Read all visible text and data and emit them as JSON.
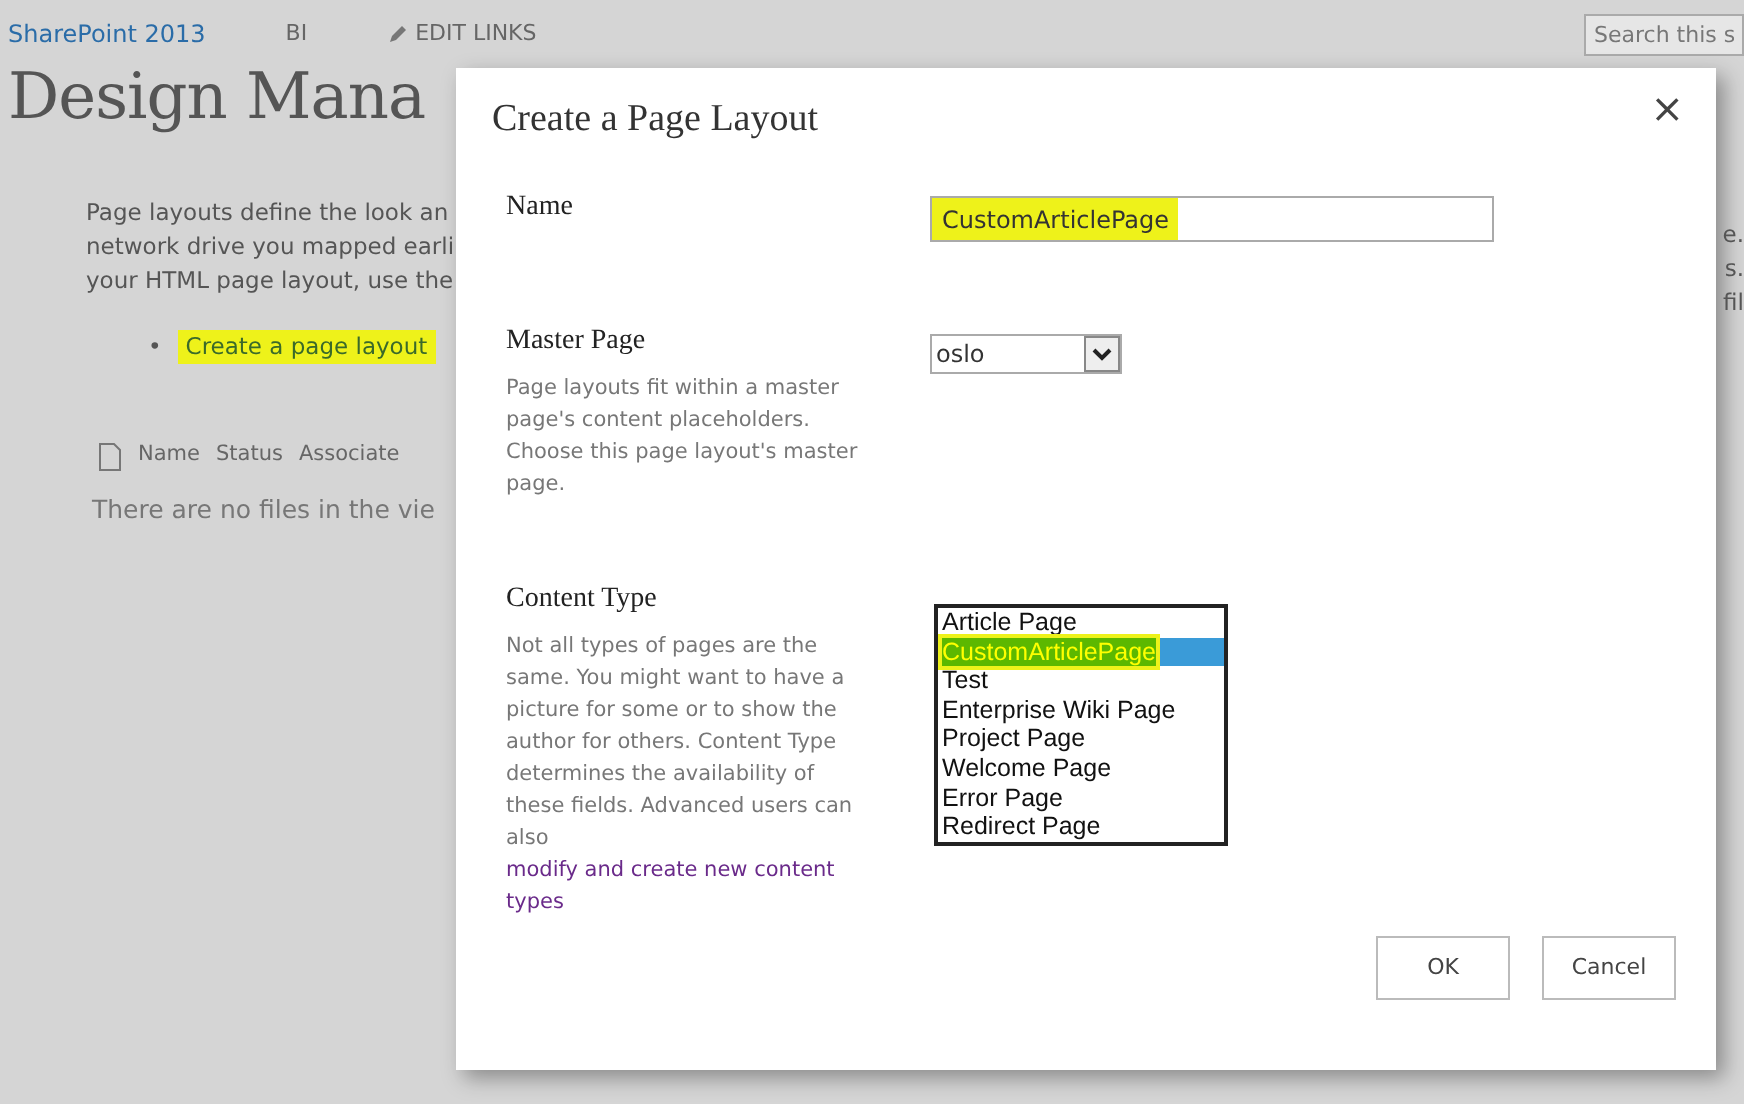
{
  "top_bar": {
    "site_title": "SharePoint 2013",
    "links": [
      "BI",
      "EDIT LINKS"
    ],
    "search": {
      "placeholder": "Search this s"
    }
  },
  "page": {
    "title": "Design Mana",
    "intro_lines": [
      "Page layouts define the look an",
      "network drive you mapped earli",
      "your HTML page layout, use the"
    ],
    "right_fragments": [
      "e.",
      "s.",
      "fil"
    ],
    "action_link": {
      "bullet": "•",
      "label": "Create a page layout",
      "highlighted": true
    },
    "columns": [
      "Name",
      "Status",
      "Associate"
    ],
    "empty_message": "There are no files in the vie"
  },
  "dialog": {
    "title": "Create a Page Layout",
    "close": "×",
    "name_section": {
      "label": "Name",
      "value": "CustomArticlePage",
      "highlighted": true
    },
    "master_section": {
      "label": "Master Page",
      "description": "Page layouts fit within a master page's content placeholders. Choose this page layout's master page.",
      "value": "oslo"
    },
    "content_type_section": {
      "label": "Content Type",
      "description": "Not all types of pages are the same. You might want to have a picture for some or to show the author for others. Content Type determines the availability of these fields. Advanced users can also",
      "link": "modify and create new content types",
      "options": [
        {
          "label": "Article Page",
          "selected": false,
          "highlighted": false
        },
        {
          "label": "CustomArticlePage",
          "selected": true,
          "highlighted": true
        },
        {
          "label": "Test",
          "selected": false,
          "highlighted": false
        },
        {
          "label": "Enterprise Wiki Page",
          "selected": false,
          "highlighted": false
        },
        {
          "label": "Project Page",
          "selected": false,
          "highlighted": false
        },
        {
          "label": "Welcome Page",
          "selected": false,
          "highlighted": false
        },
        {
          "label": "Error Page",
          "selected": false,
          "highlighted": false
        },
        {
          "label": "Redirect Page",
          "selected": false,
          "highlighted": false
        }
      ]
    },
    "buttons": [
      "OK",
      "Cancel"
    ]
  }
}
